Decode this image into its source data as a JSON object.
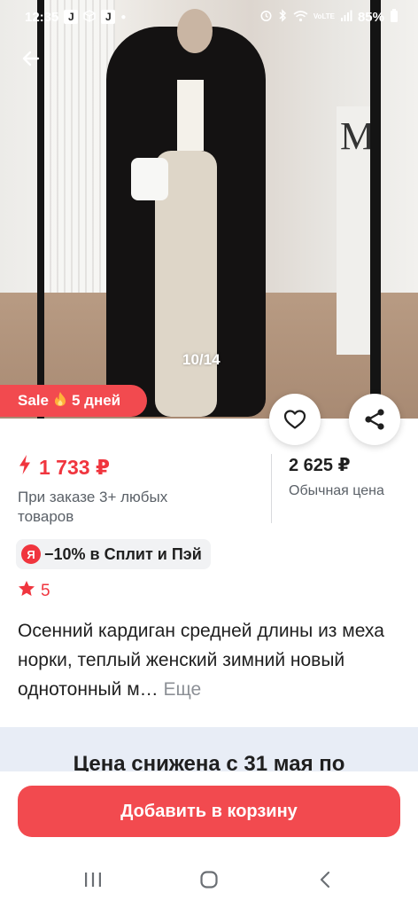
{
  "status_bar": {
    "time": "12:35",
    "battery": "85%",
    "notification_icons": [
      "j-icon",
      "box-icon",
      "j-icon",
      "dot-icon"
    ],
    "system_icons": [
      "alarm-icon",
      "bluetooth-icon",
      "wifi-icon",
      "volte-icon",
      "signal-icon"
    ],
    "volte_label": "VoLTE"
  },
  "gallery": {
    "counter": "10/14",
    "current_image": 10,
    "total_images": 14,
    "background_letter": "M"
  },
  "sale_badge": {
    "label": "Sale",
    "icon": "fire-icon",
    "duration": "5 дней"
  },
  "price": {
    "promo_price": "1 733 ₽",
    "promo_condition": "При заказе 3+ любых товаров",
    "regular_price": "2 625 ₽",
    "regular_label": "Обычная цена"
  },
  "split": {
    "icon_letter": "Я",
    "text": "−10% в Сплит и Пэй"
  },
  "rating": {
    "value": "5"
  },
  "product": {
    "title": "Осенний кардиган средней длины из меха норки, теплый женский зимний новый однотонный м…",
    "more_label": "Еще"
  },
  "price_drop": {
    "text": "Цена снижена с 31 мая по"
  },
  "actions": {
    "add_to_cart": "Добавить в корзину"
  },
  "colors": {
    "accent": "#f24a4f",
    "price_red": "#f0353e",
    "muted_text": "#5b6168",
    "banner_bg": "#e8edf6"
  }
}
